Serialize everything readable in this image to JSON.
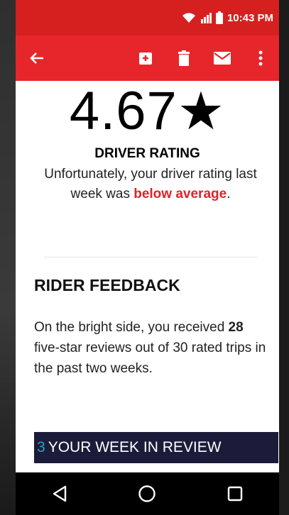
{
  "status_bar": {
    "time": "10:43 PM"
  },
  "toolbar": {
    "back_icon": "arrow-back-icon",
    "archive_icon": "archive-icon",
    "delete_icon": "trash-icon",
    "mail_icon": "mail-icon",
    "more_icon": "more-vert-icon"
  },
  "rating": {
    "value": "4.67",
    "star": "★",
    "label": "DRIVER RATING",
    "message_prefix": "Unfortunately, your driver rating last week was ",
    "message_highlight": "below average",
    "message_suffix": "."
  },
  "feedback": {
    "title": "RIDER FEEDBACK",
    "text_prefix": "On the bright side, you received ",
    "count": "28",
    "text_suffix": " five-star reviews out of 30 rated trips in the past two weeks."
  },
  "week_review": {
    "number": "3",
    "label": "YOUR WEEK IN REVIEW"
  },
  "nav": {
    "back": "back-nav-icon",
    "home": "home-nav-icon",
    "recents": "recents-nav-icon"
  },
  "colors": {
    "brand_red": "#e6262a",
    "status_red": "#d61f1f",
    "warning_red": "#e0232a",
    "banner_navy": "#1c1c3a",
    "banner_accent": "#1fa3c6"
  }
}
